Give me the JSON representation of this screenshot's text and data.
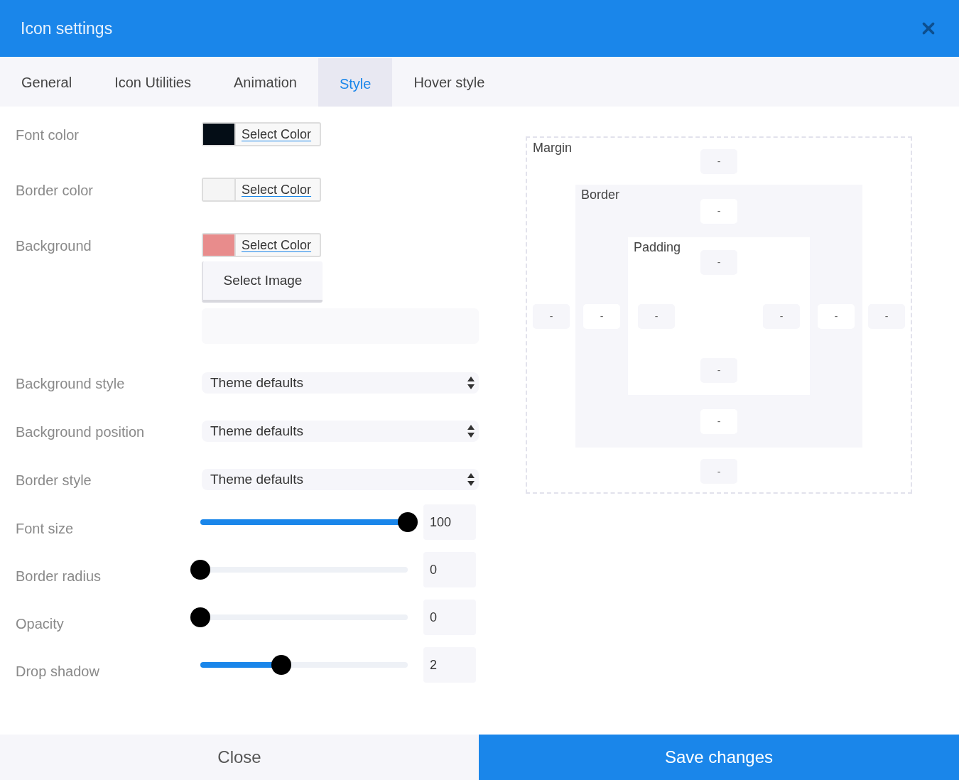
{
  "dialog": {
    "title": "Icon settings"
  },
  "tabs": [
    {
      "label": "General",
      "selected": false
    },
    {
      "label": "Icon Utilities",
      "selected": false
    },
    {
      "label": "Animation",
      "selected": false
    },
    {
      "label": "Style",
      "selected": true
    },
    {
      "label": "Hover style",
      "selected": false
    }
  ],
  "fields": [
    {
      "kind": "color",
      "label": "Font color",
      "color": "#040d16",
      "button": "Select Color"
    },
    {
      "kind": "color",
      "label": "Border color",
      "color": "#f5f5f5",
      "button": "Select Color"
    },
    {
      "kind": "color_image",
      "label": "Background",
      "color": "#e88c8c",
      "button": "Select Color",
      "image_button": "Select Image"
    },
    {
      "kind": "select",
      "label": "Background style",
      "value": "Theme defaults"
    },
    {
      "kind": "select",
      "label": "Background position",
      "value": "Theme defaults"
    },
    {
      "kind": "select",
      "label": "Border style",
      "value": "Theme defaults"
    },
    {
      "kind": "slider",
      "label": "Font size",
      "level": 1,
      "value": "100"
    },
    {
      "kind": "slider",
      "label": "Border radius",
      "level": 0,
      "value": "0"
    },
    {
      "kind": "slider",
      "label": "Opacity",
      "level": 0,
      "value": "0"
    },
    {
      "kind": "slider",
      "label": "Drop shadow",
      "level": 0.39,
      "value": "2"
    }
  ],
  "box_model": {
    "label": "Margin",
    "top": "-",
    "left": "-",
    "inner": {
      "label": "Border",
      "top": "-",
      "left": "-",
      "inner": {
        "label": "Padding",
        "top": "-",
        "left": "-",
        "right": "-",
        "bottom": "-"
      },
      "right": "-",
      "bottom": "-"
    },
    "right": "-",
    "bottom": "-"
  },
  "footer": {
    "close": "Close",
    "save": "Save changes"
  }
}
